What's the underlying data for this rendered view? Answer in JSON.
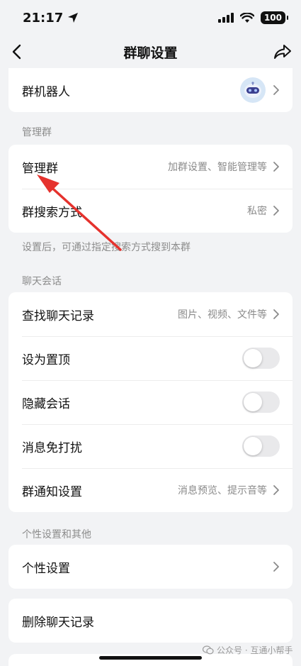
{
  "status_bar": {
    "time": "21:17",
    "battery": "100"
  },
  "nav": {
    "title": "群聊设置",
    "back_icon": "chevron-left-icon",
    "share_icon": "share-arrow-icon"
  },
  "bot_row": {
    "label": "群机器人"
  },
  "section_manage": {
    "header": "管理群",
    "rows": [
      {
        "label": "管理群",
        "value": "加群设置、智能管理等"
      },
      {
        "label": "群搜索方式",
        "value": "私密"
      }
    ],
    "hint": "设置后，可通过指定搜索方式搜到本群"
  },
  "section_chat": {
    "header": "聊天会话",
    "rows": [
      {
        "label": "查找聊天记录",
        "value": "图片、视频、文件等"
      },
      {
        "label": "设为置顶"
      },
      {
        "label": "隐藏会话"
      },
      {
        "label": "消息免打扰"
      },
      {
        "label": "群通知设置",
        "value": "消息预览、提示音等"
      }
    ]
  },
  "section_personal": {
    "header": "个性设置和其他",
    "rows": [
      {
        "label": "个性设置"
      }
    ]
  },
  "delete_row": {
    "label": "删除聊天记录"
  },
  "watermark": {
    "text": "公众号 · 互通小帮手"
  },
  "colors": {
    "background": "#f2f3f5",
    "annotation_arrow": "#e5322d",
    "toggle_off": "#e9e9eb"
  }
}
